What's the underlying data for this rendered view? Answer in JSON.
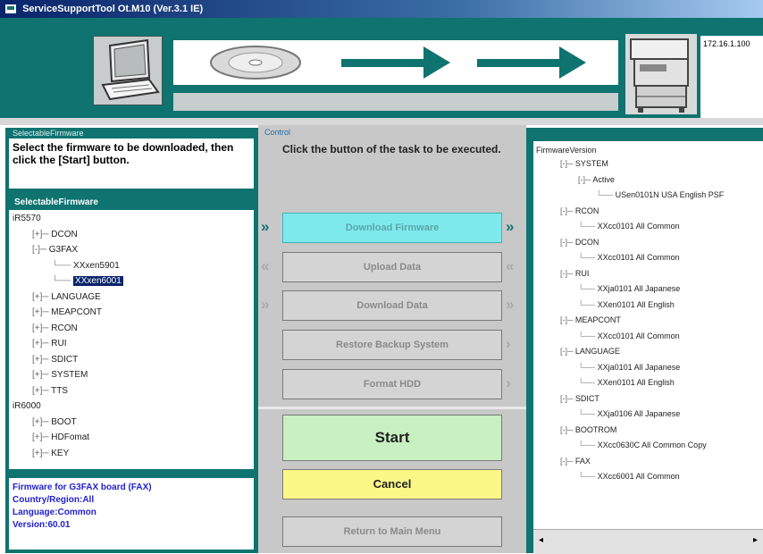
{
  "window": {
    "title": "ServiceSupportTool Ot.M10 (Ver.3.1 IE)"
  },
  "banner": {
    "ip_address": "172.16.1.100"
  },
  "left_panel": {
    "legend": "SelectableFirmware",
    "instruction": "Select the firmware to be downloaded, then click the [Start] button.",
    "subheading": "SelectableFirmware",
    "tree": [
      {
        "label": "iR5570",
        "level": 0,
        "expander": ""
      },
      {
        "label": "DCON",
        "level": 1,
        "expander": "+"
      },
      {
        "label": "G3FAX",
        "level": 1,
        "expander": "-"
      },
      {
        "label": "XXxen5901",
        "level": 2,
        "expander": ""
      },
      {
        "label": "XXxen6001",
        "level": 2,
        "expander": "",
        "selected": true
      },
      {
        "label": "LANGUAGE",
        "level": 1,
        "expander": "+"
      },
      {
        "label": "MEAPCONT",
        "level": 1,
        "expander": "+"
      },
      {
        "label": "RCON",
        "level": 1,
        "expander": "+"
      },
      {
        "label": "RUI",
        "level": 1,
        "expander": "+"
      },
      {
        "label": "SDICT",
        "level": 1,
        "expander": "+"
      },
      {
        "label": "SYSTEM",
        "level": 1,
        "expander": "+"
      },
      {
        "label": "TTS",
        "level": 1,
        "expander": "+"
      },
      {
        "label": "iR6000",
        "level": 0,
        "expander": ""
      },
      {
        "label": "BOOT",
        "level": 1,
        "expander": "+"
      },
      {
        "label": "HDFomat",
        "level": 1,
        "expander": "+"
      },
      {
        "label": "KEY",
        "level": 1,
        "expander": "+"
      }
    ],
    "info": {
      "line1": "Firmware for G3FAX board (FAX)",
      "line2": "Country/Region:All",
      "line3": "Language:Common",
      "line4": "Version:60.01"
    }
  },
  "control": {
    "legend": "Control",
    "instruction": "Click the button of the task to be executed.",
    "buttons": {
      "download_firmware": "Download Firmware",
      "upload_data": "Upload Data",
      "download_data": "Download Data",
      "restore_backup": "Restore Backup System",
      "format_hdd": "Format HDD",
      "start": "Start",
      "cancel": "Cancel",
      "return_main": "Return to Main Menu"
    }
  },
  "right_panel": {
    "legend": "FirmwareVersion",
    "tree": [
      {
        "label": "SYSTEM",
        "level": 1,
        "expander": "-"
      },
      {
        "label": "Active",
        "level": 2,
        "expander": "-"
      },
      {
        "label": "USen0101N USA English PSF",
        "level": 3,
        "expander": ""
      },
      {
        "label": "RCON",
        "level": 1,
        "expander": "-"
      },
      {
        "label": "XXcc0101 All Common",
        "level": 2,
        "expander": ""
      },
      {
        "label": "DCON",
        "level": 1,
        "expander": "-"
      },
      {
        "label": "XXcc0101 All Common",
        "level": 2,
        "expander": ""
      },
      {
        "label": "RUI",
        "level": 1,
        "expander": "-"
      },
      {
        "label": "XXja0101 All Japanese",
        "level": 2,
        "expander": ""
      },
      {
        "label": "XXen0101 All English",
        "level": 2,
        "expander": ""
      },
      {
        "label": "MEAPCONT",
        "level": 1,
        "expander": "-"
      },
      {
        "label": "XXcc0101 All Common",
        "level": 2,
        "expander": ""
      },
      {
        "label": "LANGUAGE",
        "level": 1,
        "expander": "-"
      },
      {
        "label": "XXja0101 All Japanese",
        "level": 2,
        "expander": ""
      },
      {
        "label": "XXen0101 All English",
        "level": 2,
        "expander": ""
      },
      {
        "label": "SDICT",
        "level": 1,
        "expander": "-"
      },
      {
        "label": "XXja0106 All Japanese",
        "level": 2,
        "expander": ""
      },
      {
        "label": "BOOTROM",
        "level": 1,
        "expander": "-"
      },
      {
        "label": "XXcc0630C All Common Copy",
        "level": 2,
        "expander": ""
      },
      {
        "label": "FAX",
        "level": 1,
        "expander": "-"
      },
      {
        "label": "XXcc6001 All Common",
        "level": 2,
        "expander": ""
      }
    ]
  },
  "colors": {
    "teal": "#0f7370",
    "active_button": "#7de9ec",
    "start_button": "#c8f0c0",
    "cancel_button": "#fcf888",
    "selection": "#0a246a"
  },
  "icons": [
    "app-icon",
    "laptop-icon",
    "cd-disc-icon",
    "arrow-right-icon",
    "printer-icon",
    "double-chevron-icon"
  ]
}
